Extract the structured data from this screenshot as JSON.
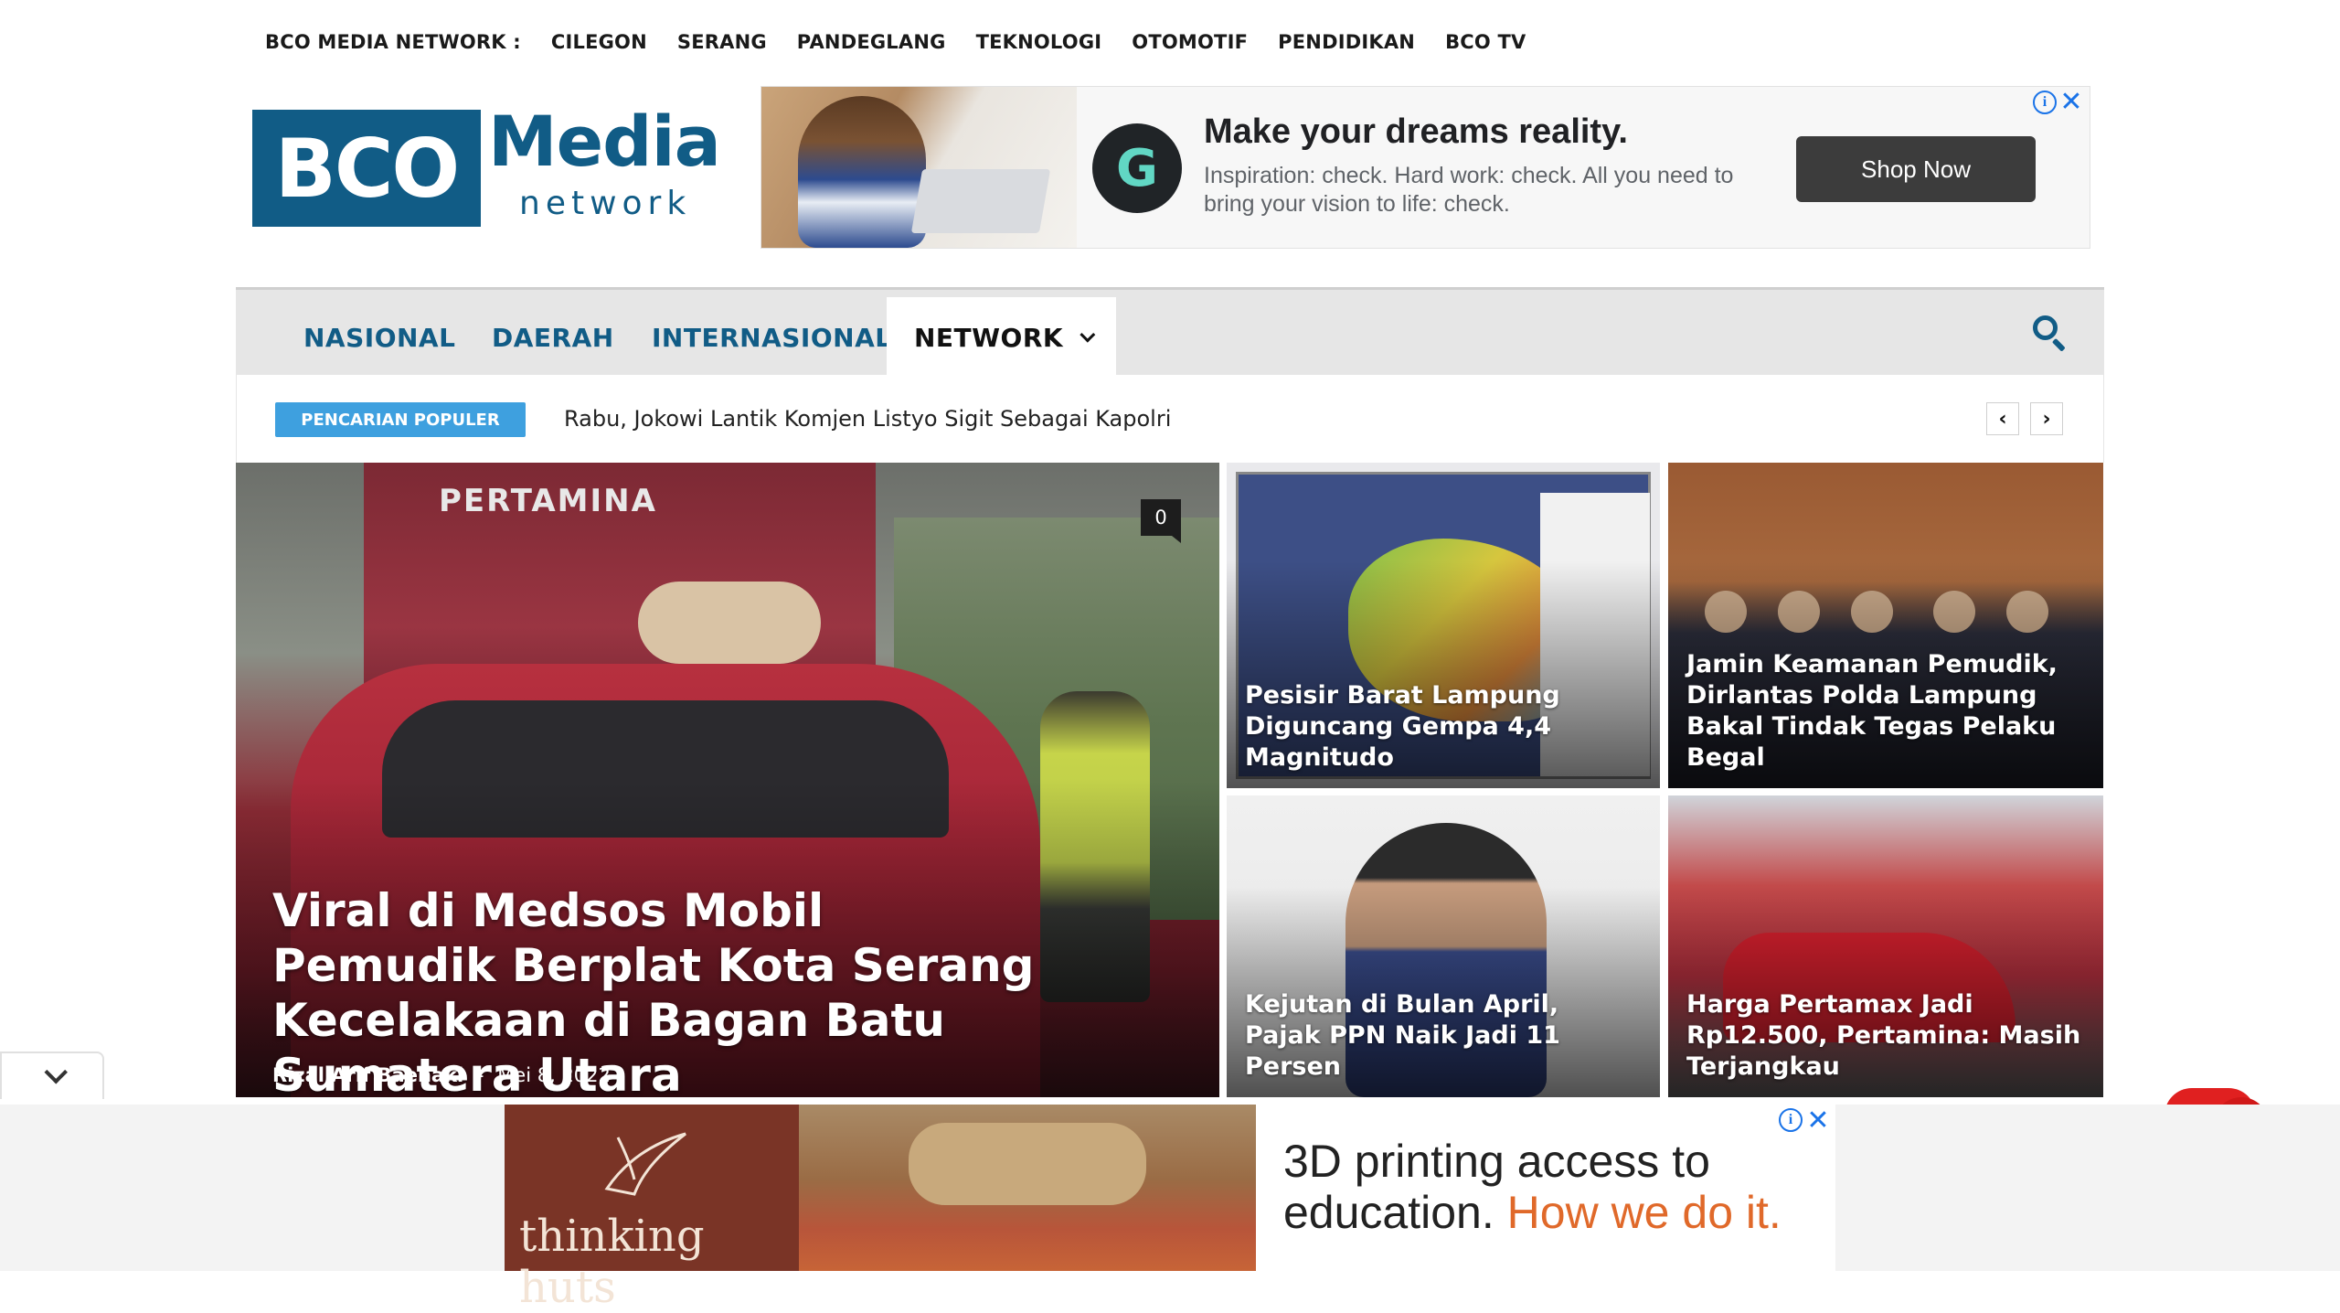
{
  "topnav": {
    "items": [
      "BCO MEDIA NETWORK :",
      "CILEGON",
      "SERANG",
      "PANDEGLANG",
      "TEKNOLOGI",
      "OTOMOTIF",
      "PENDIDIKAN",
      "BCO TV"
    ]
  },
  "logo": {
    "primary": "BCO",
    "secondary": "Media",
    "tertiary": "network"
  },
  "ad_top": {
    "headline": "Make your dreams reality.",
    "body": "Inspiration: check. Hard work: check. All you need to bring your vision to life: check.",
    "cta": "Shop Now",
    "info_glyph": "i",
    "close_glyph": "✕"
  },
  "mainnav": {
    "items": [
      "NASIONAL",
      "DAERAH",
      "INTERNASIONAL",
      "NETWORK"
    ],
    "active": "NETWORK"
  },
  "ticker": {
    "label": "PENCARIAN POPULER",
    "headline": "Rabu, Jokowi Lantik Komjen Listyo Sigit Sebagai Kapolri",
    "prev": "‹",
    "next": "›"
  },
  "featured": {
    "main": {
      "title": "Viral di Medsos Mobil Pemudik Berplat Kota Serang Kecelakaan di Bagan Batu Sumatera Utara",
      "author": "Rizal Arif Baehaki",
      "separator": "-",
      "date": "Mei 8, 2022",
      "comments": "0",
      "image_text": "PERTAMINA"
    },
    "tiles": [
      {
        "title": "Pesisir Barat Lampung Diguncang Gempa 4,4 Magnitudo"
      },
      {
        "title": "Jamin Keamanan Pemudik, Dirlantas Polda Lampung Bakal Tindak Tegas Pelaku Begal"
      },
      {
        "title": "Kejutan di Bulan April, Pajak PPN Naik Jadi 11 Persen"
      },
      {
        "title": "Harga Pertamax Jadi Rp12.500, Pertamina: Masih Terjangkau"
      }
    ]
  },
  "ad_bottom": {
    "brand": "thinking huts",
    "copy_line1": "3D printing access to",
    "copy_line2": "education.",
    "copy_highlight": "How we do it.",
    "info_glyph": "i",
    "close_glyph": "✕"
  }
}
